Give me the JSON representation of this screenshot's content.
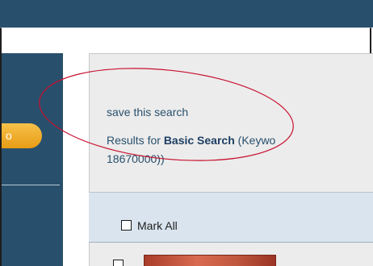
{
  "sidebar": {
    "button_label": "o"
  },
  "results": {
    "save_search_link": "save this search",
    "results_prefix": "Results for ",
    "search_type": "Basic Search",
    "keyword_prefix": " (Keywo",
    "keyword_continuation": "18670000))"
  },
  "list": {
    "mark_all_label": "Mark All"
  },
  "colors": {
    "header_blue": "#28506d",
    "accent_orange": "#f0a52a",
    "panel_gray": "#ececec",
    "row_blue": "#d9e4ee",
    "annotation_red": "#c8102e"
  }
}
